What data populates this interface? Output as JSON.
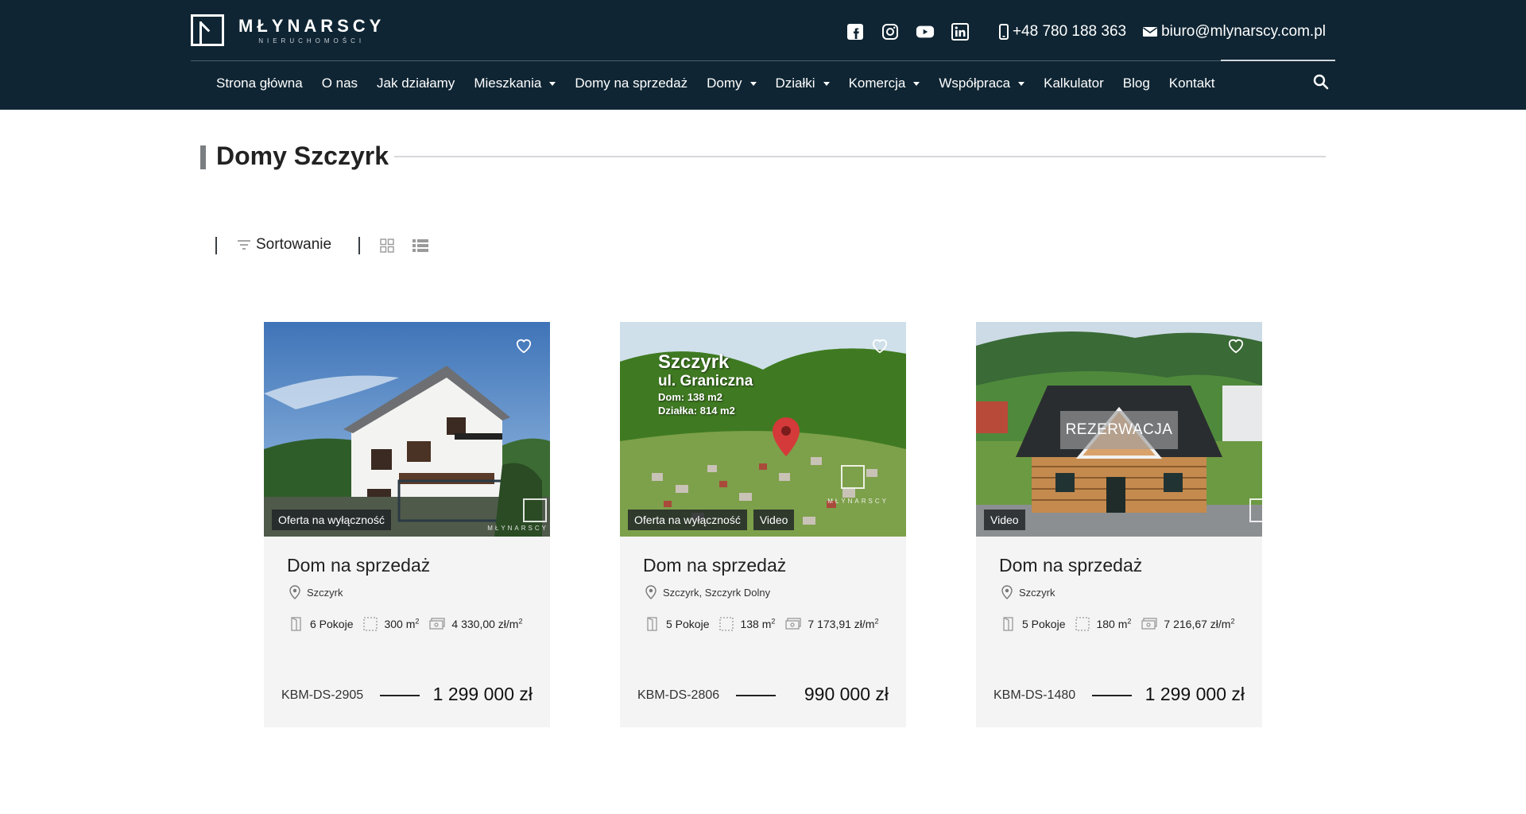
{
  "brand": {
    "name": "MŁYNARSCY",
    "subtitle": "NIERUCHOMOŚCI"
  },
  "header": {
    "social": [
      "facebook-icon",
      "instagram-icon",
      "youtube-icon",
      "linkedin-icon"
    ],
    "phone": "+48 780 188 363",
    "email": "biuro@mlynarscy.com.pl"
  },
  "nav": {
    "items": [
      {
        "label": "Strona główna",
        "dropdown": false
      },
      {
        "label": "O nas",
        "dropdown": false
      },
      {
        "label": "Jak działamy",
        "dropdown": false
      },
      {
        "label": "Mieszkania",
        "dropdown": true
      },
      {
        "label": "Domy na sprzedaż",
        "dropdown": false
      },
      {
        "label": "Domy",
        "dropdown": true
      },
      {
        "label": "Działki",
        "dropdown": true
      },
      {
        "label": "Komercja",
        "dropdown": true
      },
      {
        "label": "Współpraca",
        "dropdown": true
      },
      {
        "label": "Kalkulator",
        "dropdown": false
      },
      {
        "label": "Blog",
        "dropdown": false
      },
      {
        "label": "Kontakt",
        "dropdown": false
      }
    ]
  },
  "page": {
    "title_prefix": "Domy",
    "title_bold": "Szczyrk"
  },
  "toolbar": {
    "sort_label": "Sortowanie"
  },
  "listings": [
    {
      "title": "Dom na sprzedaż",
      "location": "Szczyrk",
      "rooms": "6 Pokoje",
      "area": "300 m",
      "price_per_m2": "4 330,00 zł/m",
      "code": "KBM-DS-2905",
      "price": "1 299 000 zł",
      "badges": [
        "Oferta na wyłączność"
      ]
    },
    {
      "title": "Dom na sprzedaż",
      "location": "Szczyrk, Szczyrk Dolny",
      "rooms": "5 Pokoje",
      "area": "138 m",
      "price_per_m2": "7 173,91 zł/m",
      "code": "KBM-DS-2806",
      "price": "990 000 zł",
      "badges": [
        "Oferta na wyłączność",
        "Video"
      ],
      "overlay": {
        "city": "Szczyrk",
        "street": "ul. Graniczna",
        "house": "Dom: 138 m2",
        "plot": "Działka: 814 m2"
      }
    },
    {
      "title": "Dom na sprzedaż",
      "location": "Szczyrk",
      "rooms": "5 Pokoje",
      "area": "180 m",
      "price_per_m2": "7 216,67 zł/m",
      "code": "KBM-DS-1480",
      "price": "1 299 000 zł",
      "badges": [
        "Video"
      ],
      "status": "REZERWACJA"
    }
  ],
  "superscript": "2",
  "watermark_text": "MŁYNARSCY",
  "colors": {
    "header_bg": "#0f2533",
    "card_bg": "#f4f4f4",
    "title_accent": "#7b7e81"
  }
}
